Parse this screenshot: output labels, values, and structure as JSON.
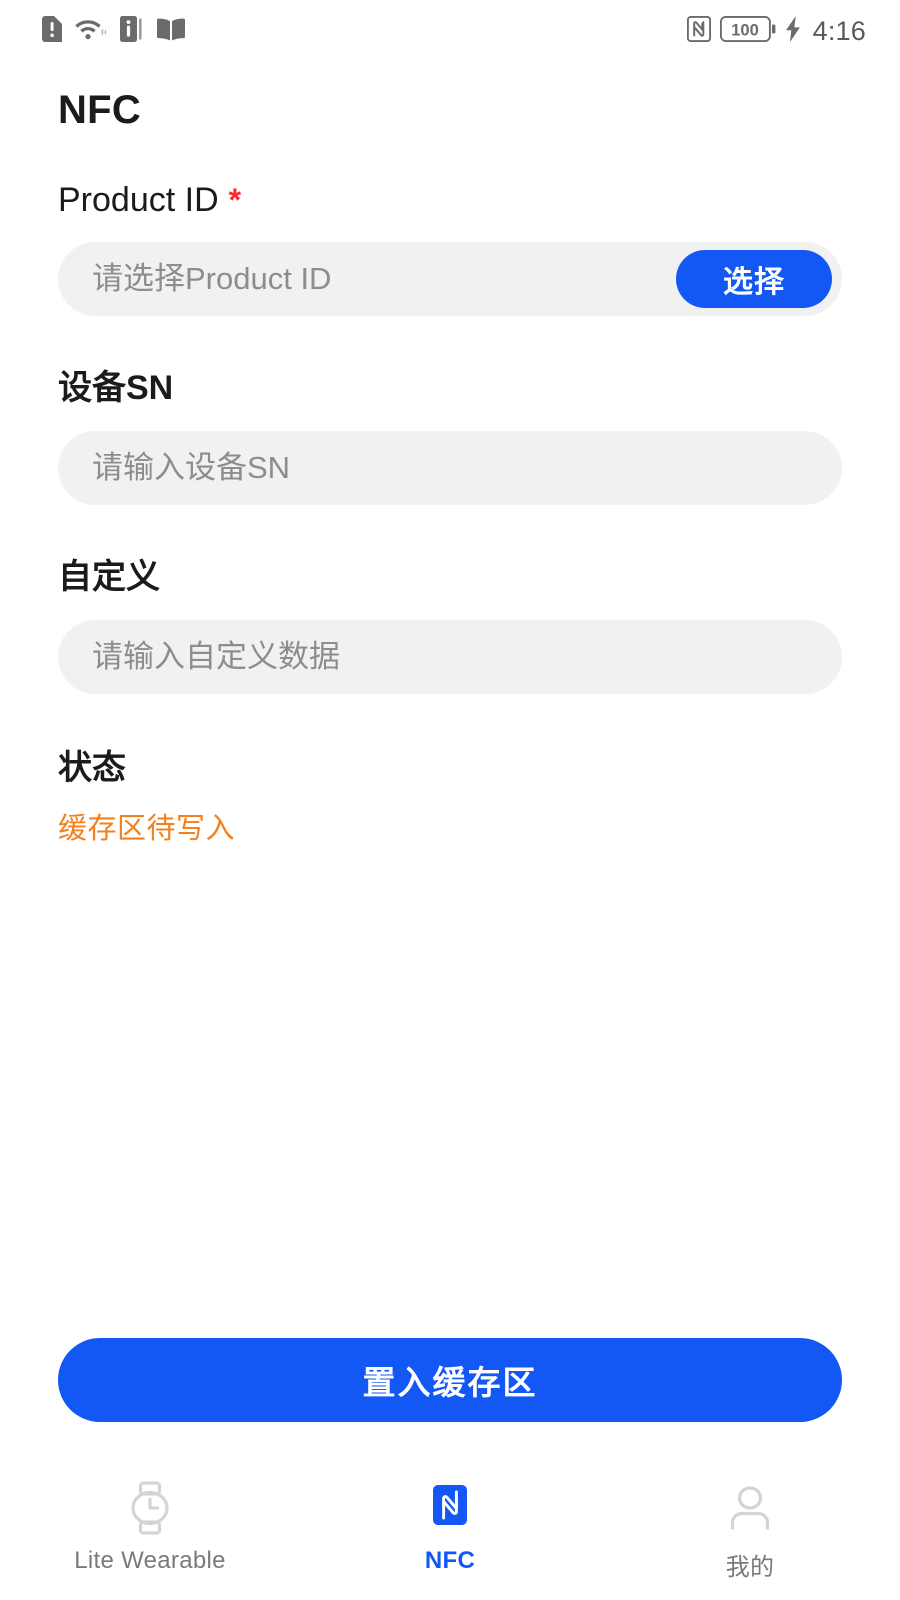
{
  "statusbar": {
    "time": "4:16",
    "battery_level": "100",
    "left_icons": [
      "sim-alert-icon",
      "wifi-icon",
      "info-icon",
      "book-icon"
    ],
    "right_icons": [
      "nfc-icon",
      "battery-icon",
      "charging-bolt-icon"
    ]
  },
  "header": {
    "title": "NFC"
  },
  "form": {
    "product_id": {
      "label": "Product ID",
      "required_mark": "*",
      "placeholder": "请选择Product ID",
      "value": "",
      "button_label": "选择"
    },
    "device_sn": {
      "label": "设备SN",
      "placeholder": "请输入设备SN",
      "value": ""
    },
    "custom": {
      "label": "自定义",
      "placeholder": "请输入自定义数据",
      "value": ""
    },
    "status": {
      "label": "状态",
      "value": "缓存区待写入"
    }
  },
  "action": {
    "primary_label": "置入缓存区"
  },
  "tabbar": {
    "items": [
      {
        "label": "Lite Wearable",
        "icon": "watch-icon",
        "active": false
      },
      {
        "label": "NFC",
        "icon": "nfc-logo-icon",
        "active": true
      },
      {
        "label": "我的",
        "icon": "person-icon",
        "active": false
      }
    ]
  },
  "colors": {
    "accent_blue": "#1358f5",
    "status_orange": "#f2811d",
    "required_red": "#fa2a2d",
    "input_bg": "#f1f1f1",
    "placeholder_gray": "#8d8d8d",
    "tab_inactive": "#7a7a7a",
    "tab_icon_gray": "#d4d4d4"
  }
}
